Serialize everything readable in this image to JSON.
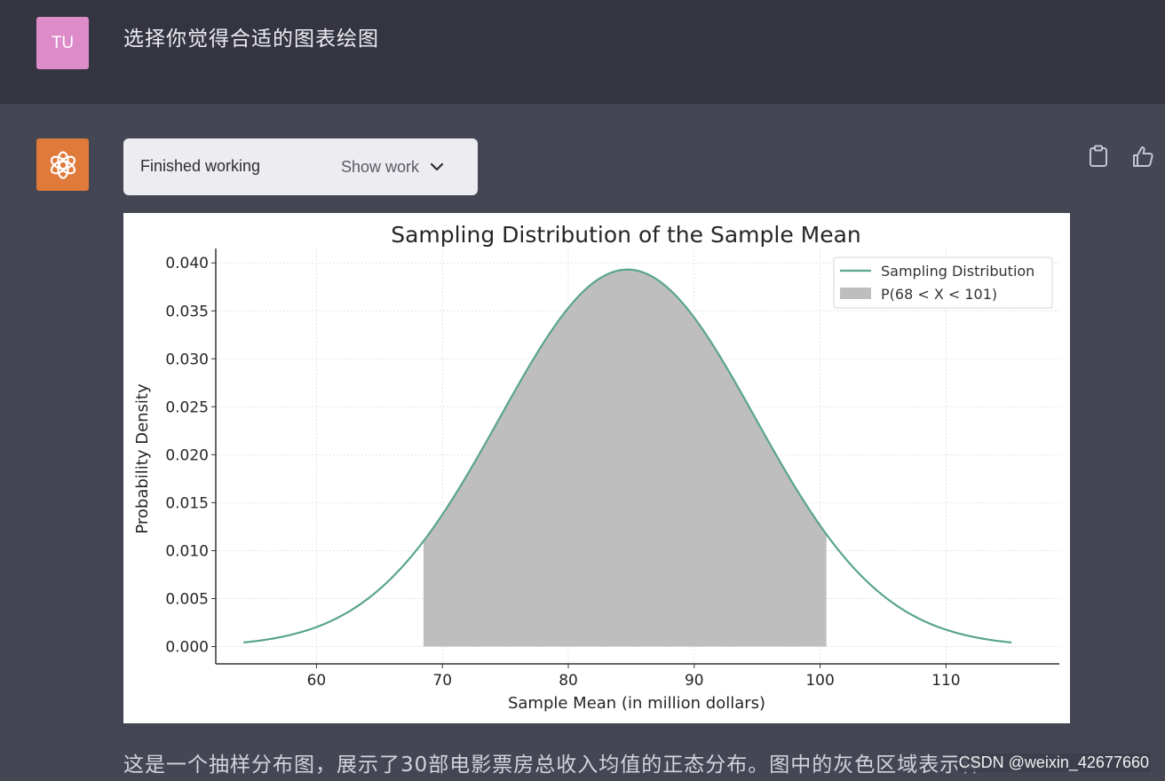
{
  "user": {
    "avatar_initials": "TU",
    "avatar_color": "#de8bc9",
    "message": "选择你觉得合适的图表绘图"
  },
  "assistant": {
    "avatar_icon": "openai-logo-icon",
    "avatar_color": "#e07a3a",
    "status_label": "Finished working",
    "show_work_label": "Show work",
    "action_icons": [
      "clipboard-icon",
      "thumbs-up-icon"
    ],
    "reply_text": "这是一个抽样分布图，展示了30部电影票房总收入均值的正态分布。图中的灰色区域表示样"
  },
  "watermark": "CSDN @weixin_42677660",
  "chart_data": {
    "type": "area",
    "title": "Sampling Distribution of the Sample Mean",
    "xlabel": "Sample Mean (in million dollars)",
    "ylabel": "Probability Density",
    "xlim": [
      52,
      119
    ],
    "ylim": [
      -0.0018,
      0.0415
    ],
    "xticks": [
      60,
      70,
      80,
      90,
      100,
      110
    ],
    "yticks": [
      "0.000",
      "0.005",
      "0.010",
      "0.015",
      "0.020",
      "0.025",
      "0.030",
      "0.035",
      "0.040"
    ],
    "distribution": {
      "mean": 84.7,
      "sd": 10.15,
      "x_range": [
        54.2,
        115.2
      ]
    },
    "shaded_region": {
      "from": 68.5,
      "to": 100.5,
      "color": "#bebebe"
    },
    "line_color": "#5aa58c",
    "grid": true,
    "legend_position": "upper-right",
    "series": [
      {
        "name": "Sampling Distribution",
        "kind": "line"
      },
      {
        "name": "P(68 < X < 101)",
        "kind": "fill"
      }
    ]
  }
}
